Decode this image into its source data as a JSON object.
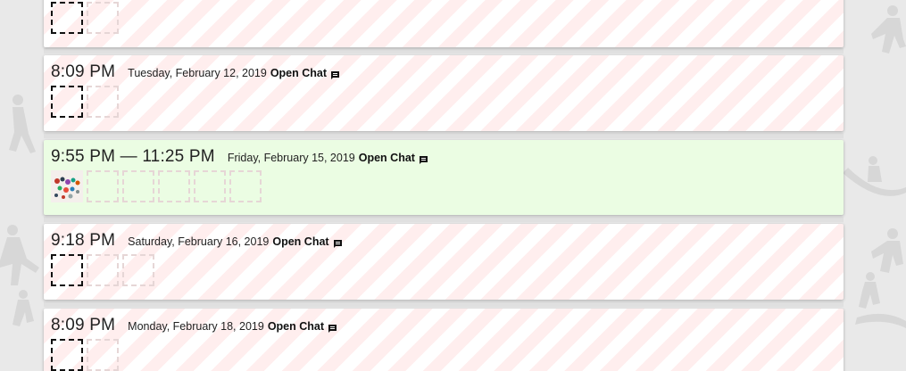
{
  "cards": [
    {
      "time": "",
      "date": "",
      "open_chat": "",
      "slots": [
        "primary",
        "empty"
      ],
      "highlight": false
    },
    {
      "time": "8:09 PM",
      "date": "Tuesday, February 12, 2019",
      "open_chat": "Open Chat",
      "slots": [
        "primary",
        "empty"
      ],
      "highlight": false
    },
    {
      "time": "9:55 PM — 11:25 PM",
      "date": "Friday, February 15, 2019",
      "open_chat": "Open Chat",
      "slots": [
        "filled",
        "empty",
        "empty",
        "empty",
        "empty",
        "empty"
      ],
      "highlight": true
    },
    {
      "time": "9:18 PM",
      "date": "Saturday, February 16, 2019",
      "open_chat": "Open Chat",
      "slots": [
        "primary",
        "empty",
        "empty"
      ],
      "highlight": false
    },
    {
      "time": "8:09 PM",
      "date": "Monday, February 18, 2019",
      "open_chat": "Open Chat",
      "slots": [
        "primary",
        "empty"
      ],
      "highlight": false
    }
  ],
  "colors": {
    "card_highlight_bg": "#ebfde3",
    "stripe": "#ffd7d7",
    "page_bg": "#e9e9e9",
    "figure_silhouette": "#b8b8b8"
  },
  "icons": {
    "open_chat": "chat-bubble-icon",
    "filled_slot": "group-photo-thumbnail"
  }
}
